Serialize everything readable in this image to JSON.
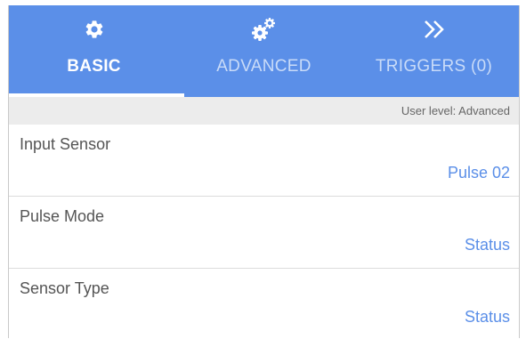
{
  "tabs": [
    {
      "label": "BASIC",
      "icon": "gear-icon",
      "active": true
    },
    {
      "label": "ADVANCED",
      "icon": "gears-icon",
      "active": false
    },
    {
      "label": "TRIGGERS (0)",
      "icon": "double-chevron-right-icon",
      "active": false
    }
  ],
  "user_level": "User level: Advanced",
  "settings": [
    {
      "name": "Input Sensor",
      "value": "Pulse 02"
    },
    {
      "name": "Pulse Mode",
      "value": "Status"
    },
    {
      "name": "Sensor Type",
      "value": "Status"
    }
  ],
  "colors": {
    "accent": "#5b8fe8",
    "tab_inactive_text": "#c9dbf8",
    "subbar": "#ececec"
  }
}
